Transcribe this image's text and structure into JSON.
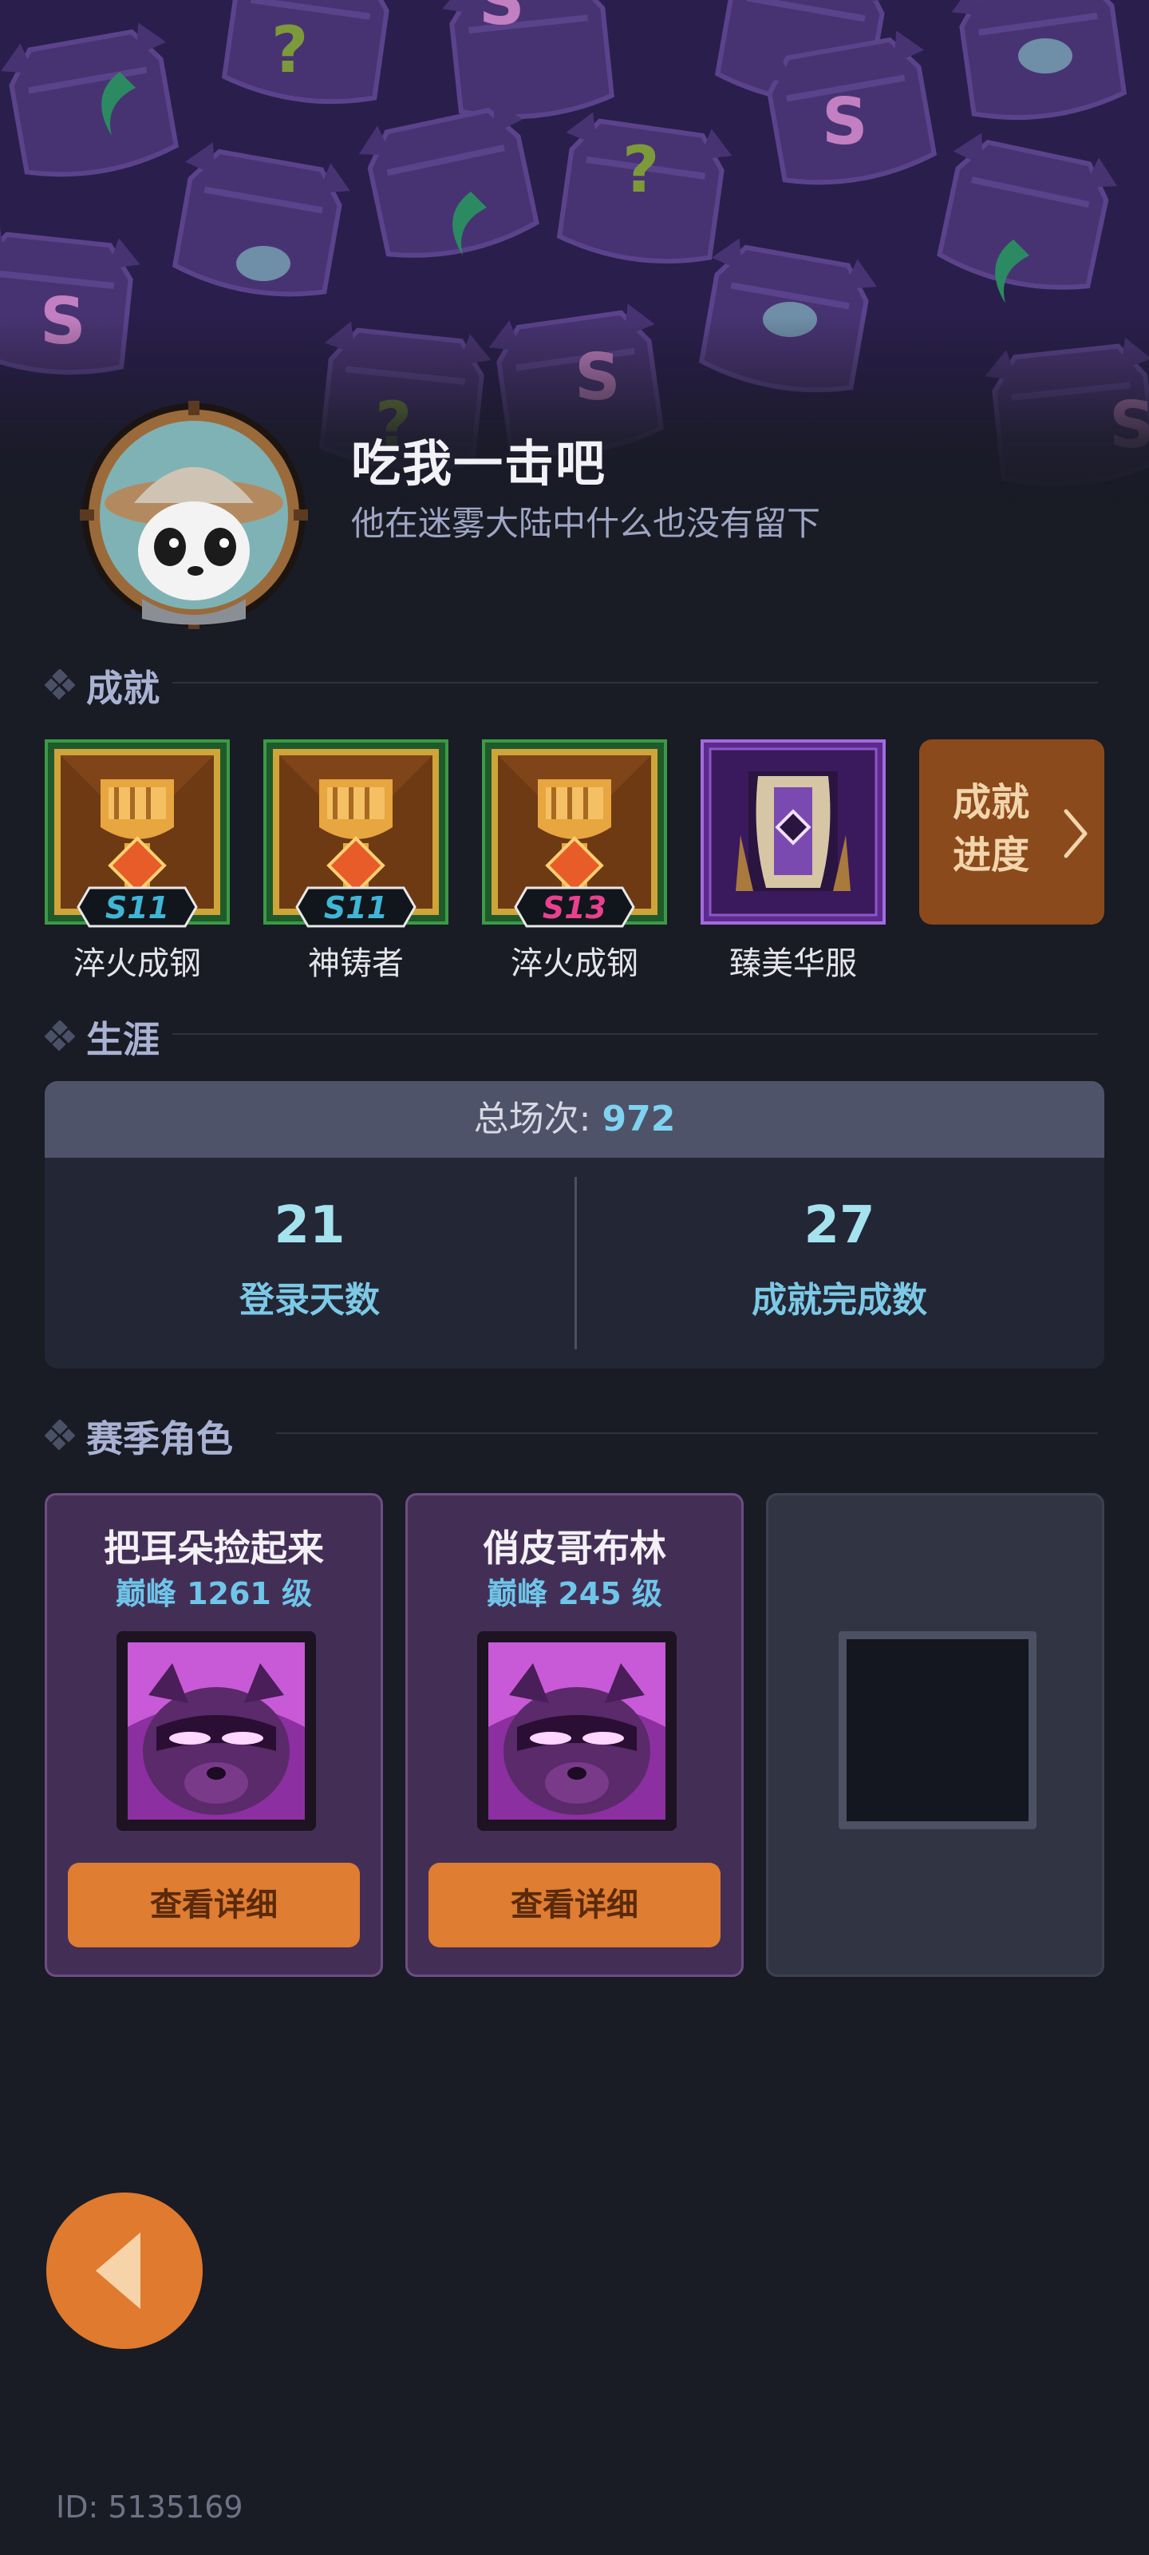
{
  "profile": {
    "name": "吃我一击吧",
    "motto": "他在迷雾大陆中什么也没有留下"
  },
  "achievements": {
    "section_title": "成就",
    "items": [
      {
        "label": "淬火成钢",
        "season": "S11",
        "icon": "fist-trophy-icon"
      },
      {
        "label": "神铸者",
        "season": "S11",
        "icon": "fist-trophy-icon"
      },
      {
        "label": "淬火成钢",
        "season": "S13",
        "icon": "fist-trophy-icon"
      },
      {
        "label": "臻美华服",
        "season": "",
        "icon": "costume-card-icon"
      }
    ],
    "progress_button": "成就进度"
  },
  "career": {
    "section_title": "生涯",
    "total_label": "总场次: ",
    "total_value": "972",
    "stats": [
      {
        "value": "21",
        "label": "登录天数"
      },
      {
        "value": "27",
        "label": "成就完成数"
      }
    ]
  },
  "season_characters": {
    "section_title": "赛季角色",
    "cards": [
      {
        "name": "把耳朵捡起来",
        "level": "巅峰 1261 级",
        "button": "查看详细"
      },
      {
        "name": "俏皮哥布林",
        "level": "巅峰 245 级",
        "button": "查看详细"
      }
    ]
  },
  "footer": {
    "id_text": "ID: 5135169"
  },
  "colors": {
    "accent_orange": "#e07a2e",
    "stat_cyan": "#7cc9e6",
    "card_purple": "#432f55"
  }
}
